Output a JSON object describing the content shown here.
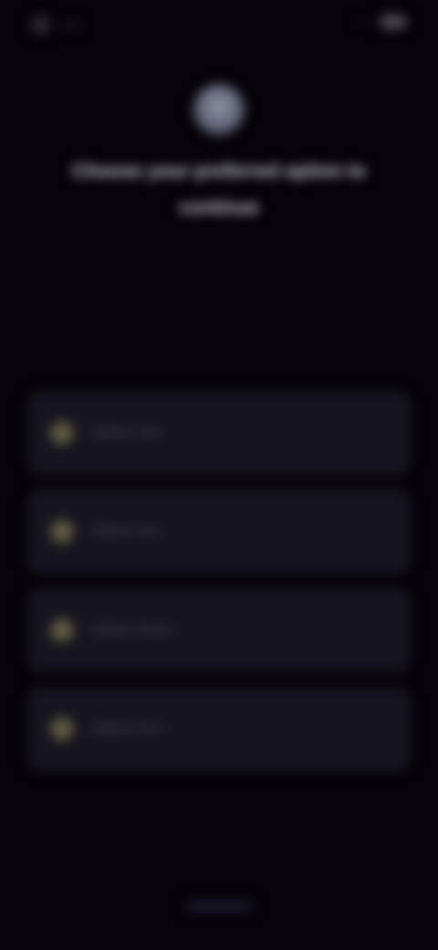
{
  "status_bar": {
    "time": "9:41",
    "signal": "•••",
    "battery_icon": "battery-icon"
  },
  "header": {
    "avatar_icon": "avatar-icon",
    "title": "Choose your preferred option to continue"
  },
  "options": [
    {
      "label": "Option one",
      "icon": "circle-icon"
    },
    {
      "label": "Option two",
      "icon": "circle-icon"
    },
    {
      "label": "Option three",
      "icon": "circle-icon"
    },
    {
      "label": "Option four",
      "icon": "circle-icon"
    }
  ],
  "footer": {
    "home_indicator": "home-indicator"
  },
  "colors": {
    "background": "#07030a",
    "card": "#16141f",
    "accent": "#6f6a4a"
  }
}
